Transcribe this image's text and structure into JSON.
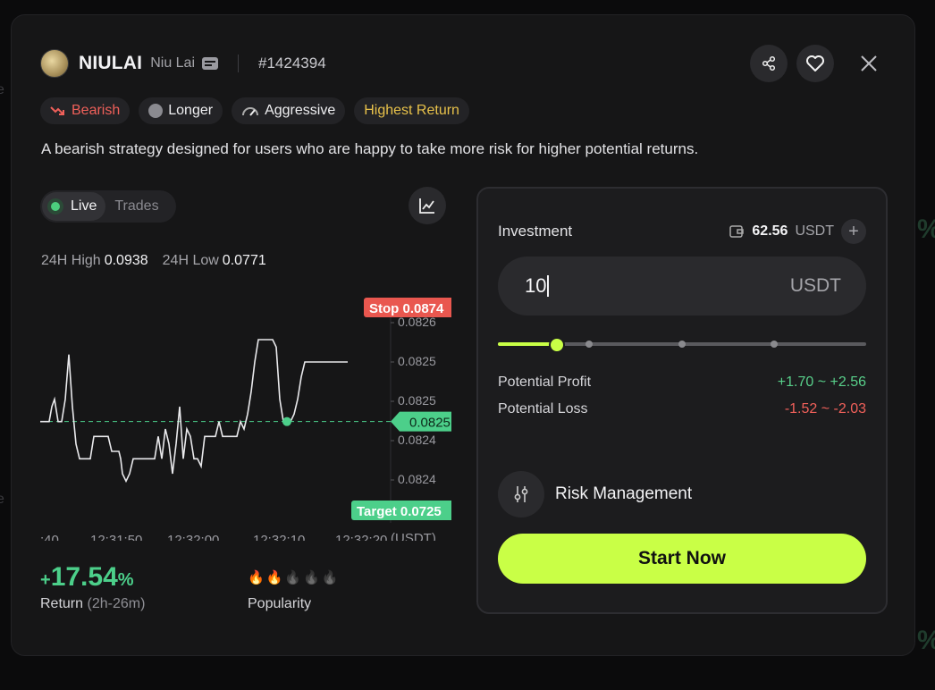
{
  "header": {
    "name": "NIULAI",
    "handle": "Niu Lai",
    "strategy_id": "#1424394"
  },
  "tags": [
    {
      "label": "Bearish"
    },
    {
      "label": "Longer"
    },
    {
      "label": "Aggressive"
    },
    {
      "label": "Highest Return"
    }
  ],
  "description": "A bearish strategy designed for users who are happy to take more risk for higher potential returns.",
  "view_toggle": {
    "live": "Live",
    "trades": "Trades"
  },
  "stats": {
    "high_label": "24H High",
    "high_value": "0.0938",
    "low_label": "24H Low",
    "low_value": "0.0771"
  },
  "chart_data": {
    "type": "line",
    "x_ticks": [
      ":40",
      "12:31:50",
      "12:32:00",
      "12:32:10",
      "12:32:20"
    ],
    "unit_label": "(USDT)",
    "y_ticks": [
      "0.0826",
      "0.0825",
      "0.0825",
      "0.0824",
      "0.0824"
    ],
    "stop_label": "Stop 0.0874",
    "current_label": "0.0825",
    "target_label": "Target 0.0725",
    "series": [
      {
        "x": [
          0,
          5,
          10,
          13,
          16,
          20,
          24,
          28,
          32,
          36,
          40,
          44,
          48,
          52,
          56,
          60,
          64,
          68,
          72,
          76,
          80,
          84,
          88,
          90,
          92,
          96,
          100,
          104,
          108,
          112,
          116,
          120,
          124,
          128,
          132,
          136,
          140,
          144,
          148,
          152,
          156,
          160,
          164,
          168,
          172,
          176,
          180,
          184,
          188,
          192,
          196,
          200,
          204,
          208,
          212,
          216,
          220,
          224,
          228,
          232,
          236,
          240,
          244,
          248,
          252,
          256,
          260,
          264,
          268,
          272,
          276,
          280,
          284,
          288,
          292,
          296,
          300,
          304,
          308,
          312,
          316,
          320,
          324,
          328,
          332,
          336,
          340,
          344
        ],
        "y": [
          0.08246,
          0.08246,
          0.08246,
          0.08248,
          0.08249,
          0.08246,
          0.08246,
          0.08249,
          0.08255,
          0.08248,
          0.08243,
          0.08241,
          0.08241,
          0.08241,
          0.08241,
          0.08244,
          0.08244,
          0.08244,
          0.08244,
          0.08244,
          0.08242,
          0.08242,
          0.08242,
          0.08241,
          0.08239,
          0.08238,
          0.08239,
          0.08241,
          0.08241,
          0.08241,
          0.08241,
          0.08241,
          0.08241,
          0.08241,
          0.08244,
          0.08241,
          0.08245,
          0.08243,
          0.08239,
          0.08243,
          0.08248,
          0.08241,
          0.08245,
          0.08244,
          0.08241,
          0.08241,
          0.0824,
          0.08244,
          0.08244,
          0.08244,
          0.08244,
          0.08246,
          0.08244,
          0.08244,
          0.08244,
          0.08244,
          0.08244,
          0.08246,
          0.08245,
          0.08247,
          0.0825,
          0.08254,
          0.08257,
          0.08257,
          0.08257,
          0.08257,
          0.08257,
          0.08256,
          0.08249,
          0.08246,
          0.08246,
          0.08246,
          0.08247,
          0.08249,
          0.08252,
          0.08254,
          0.08254,
          0.08254,
          0.08254,
          0.08254,
          0.08254,
          0.08254,
          0.08254,
          0.08254,
          0.08254,
          0.08254,
          0.08254,
          0.08254
        ]
      }
    ],
    "current_point_index": 70
  },
  "performance": {
    "return_sign": "+",
    "return_value": "17.54",
    "return_pct": "%",
    "return_label": "Return",
    "return_duration": "(2h-26m)",
    "popularity_label": "Popularity",
    "popularity_level": 2,
    "popularity_max": 5
  },
  "investment": {
    "label": "Investment",
    "balance": "62.56",
    "balance_unit": "USDT",
    "amount": "10",
    "amount_unit": "USDT",
    "slider_fraction": 0.16,
    "potential_profit_label": "Potential Profit",
    "potential_profit": "+1.70 ~ +2.56",
    "potential_loss_label": "Potential Loss",
    "potential_loss": "-1.52 ~ -2.03",
    "risk_label": "Risk Management",
    "start_label": "Start Now"
  },
  "colors": {
    "accent": "#c9ff46",
    "green": "#58cf8a",
    "red": "#f0605a",
    "gold": "#e7c14a"
  }
}
